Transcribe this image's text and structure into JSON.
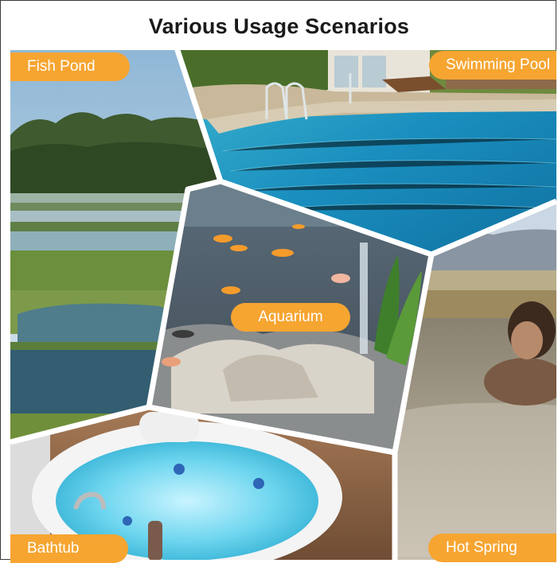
{
  "title": "Various Usage Scenarios",
  "scenarios": [
    {
      "label": "Fish Pond"
    },
    {
      "label": "Swimming Pool"
    },
    {
      "label": "Aquarium"
    },
    {
      "label": "Bathtub"
    },
    {
      "label": "Hot Spring"
    }
  ],
  "colors": {
    "label_background": "#f6a531",
    "label_text": "#ffffff",
    "divider": "#ffffff",
    "title_text": "#1a1a1a"
  }
}
